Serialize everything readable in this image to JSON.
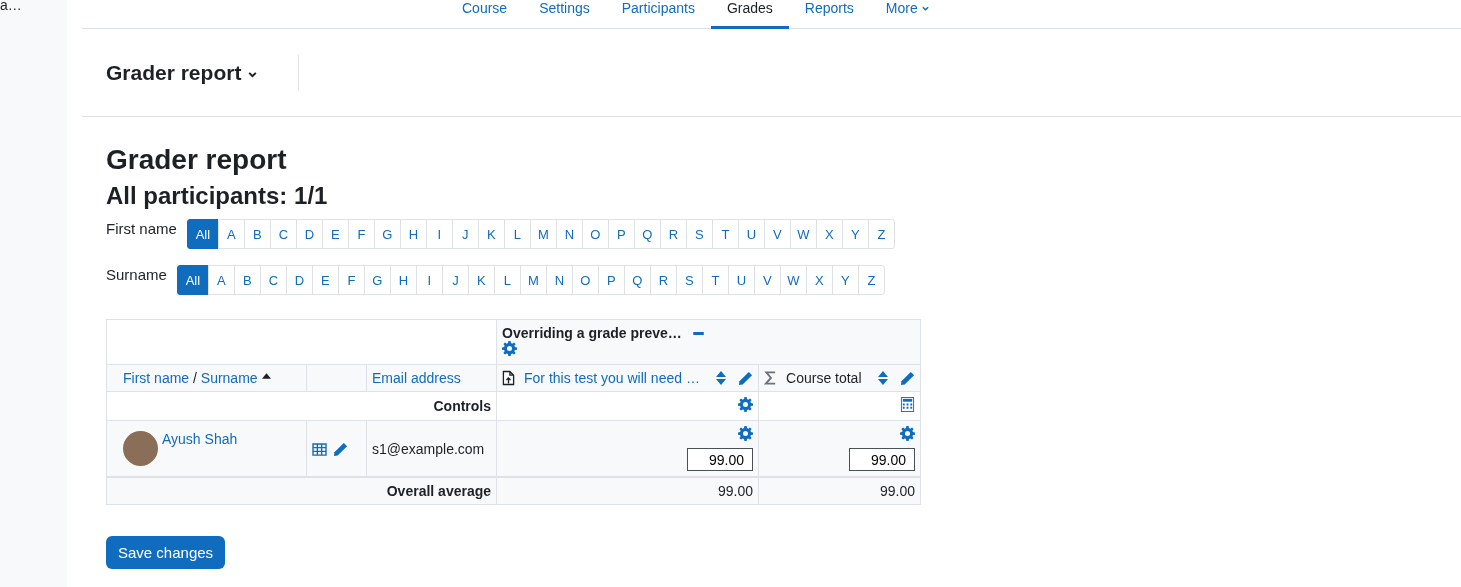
{
  "sidebar": {
    "text": "a…"
  },
  "nav": {
    "tabs": [
      {
        "label": "Course",
        "selected": false,
        "dropdown": false
      },
      {
        "label": "Settings",
        "selected": false,
        "dropdown": false
      },
      {
        "label": "Participants",
        "selected": false,
        "dropdown": false
      },
      {
        "label": "Grades",
        "selected": true,
        "dropdown": false
      },
      {
        "label": "Reports",
        "selected": false,
        "dropdown": false
      },
      {
        "label": "More",
        "selected": false,
        "dropdown": true
      }
    ]
  },
  "report_selector": {
    "label": "Grader report"
  },
  "heading": "Grader report",
  "subheading": "All participants: 1/1",
  "filters": [
    {
      "label": "First name",
      "letters": [
        {
          "label": "All",
          "selected": true
        },
        {
          "label": "A",
          "selected": false
        },
        {
          "label": "B",
          "selected": false
        },
        {
          "label": "C",
          "selected": false
        },
        {
          "label": "D",
          "selected": false
        },
        {
          "label": "E",
          "selected": false
        },
        {
          "label": "F",
          "selected": false
        },
        {
          "label": "G",
          "selected": false
        },
        {
          "label": "H",
          "selected": false
        },
        {
          "label": "I",
          "selected": false
        },
        {
          "label": "J",
          "selected": false
        },
        {
          "label": "K",
          "selected": false
        },
        {
          "label": "L",
          "selected": false
        },
        {
          "label": "M",
          "selected": false
        },
        {
          "label": "N",
          "selected": false
        },
        {
          "label": "O",
          "selected": false
        },
        {
          "label": "P",
          "selected": false
        },
        {
          "label": "Q",
          "selected": false
        },
        {
          "label": "R",
          "selected": false
        },
        {
          "label": "S",
          "selected": false
        },
        {
          "label": "T",
          "selected": false
        },
        {
          "label": "U",
          "selected": false
        },
        {
          "label": "V",
          "selected": false
        },
        {
          "label": "W",
          "selected": false
        },
        {
          "label": "X",
          "selected": false
        },
        {
          "label": "Y",
          "selected": false
        },
        {
          "label": "Z",
          "selected": false
        }
      ]
    },
    {
      "label": "Surname",
      "letters": [
        {
          "label": "All",
          "selected": true
        },
        {
          "label": "A",
          "selected": false
        },
        {
          "label": "B",
          "selected": false
        },
        {
          "label": "C",
          "selected": false
        },
        {
          "label": "D",
          "selected": false
        },
        {
          "label": "E",
          "selected": false
        },
        {
          "label": "F",
          "selected": false
        },
        {
          "label": "G",
          "selected": false
        },
        {
          "label": "H",
          "selected": false
        },
        {
          "label": "I",
          "selected": false
        },
        {
          "label": "J",
          "selected": false
        },
        {
          "label": "K",
          "selected": false
        },
        {
          "label": "L",
          "selected": false
        },
        {
          "label": "M",
          "selected": false
        },
        {
          "label": "N",
          "selected": false
        },
        {
          "label": "O",
          "selected": false
        },
        {
          "label": "P",
          "selected": false
        },
        {
          "label": "Q",
          "selected": false
        },
        {
          "label": "R",
          "selected": false
        },
        {
          "label": "S",
          "selected": false
        },
        {
          "label": "T",
          "selected": false
        },
        {
          "label": "U",
          "selected": false
        },
        {
          "label": "V",
          "selected": false
        },
        {
          "label": "W",
          "selected": false
        },
        {
          "label": "X",
          "selected": false
        },
        {
          "label": "Y",
          "selected": false
        },
        {
          "label": "Z",
          "selected": false
        }
      ]
    }
  ],
  "table": {
    "category": "Overriding a grade preve…",
    "name_header": {
      "first": "First name",
      "separator": "/",
      "last": "Surname"
    },
    "email_header": "Email address",
    "items": [
      {
        "label": "For this test you will need …",
        "kind": "assignment"
      },
      {
        "label": "Course total",
        "kind": "total"
      }
    ],
    "controls_label": "Controls",
    "rows": [
      {
        "name": "Ayush Shah",
        "email": "s1@example.com",
        "grades": [
          "99.00",
          "99.00"
        ]
      }
    ],
    "average": {
      "label": "Overall average",
      "values": [
        "99.00",
        "99.00"
      ]
    }
  },
  "save_button": "Save changes"
}
